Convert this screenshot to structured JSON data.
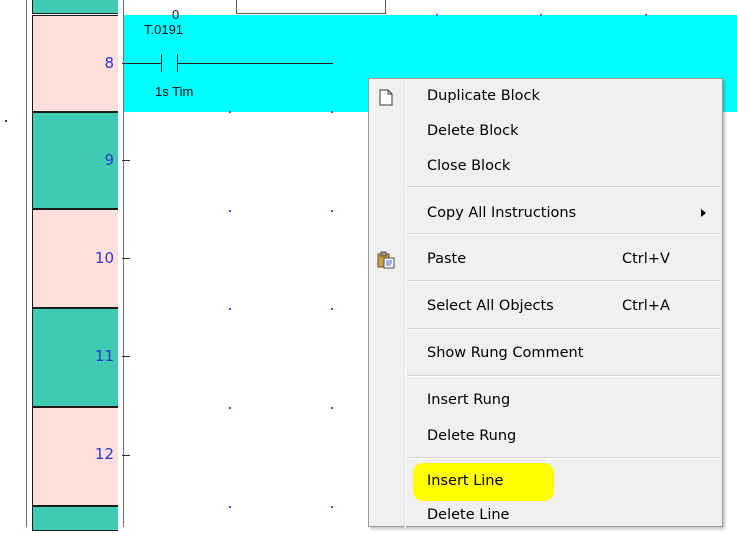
{
  "ladder": {
    "rungs": [
      {
        "number": "8",
        "fill": "#fde0dc"
      },
      {
        "number": "9",
        "fill": "#3fcbb1"
      },
      {
        "number": "10",
        "fill": "#fde0dc"
      },
      {
        "number": "11",
        "fill": "#3fcbb1"
      },
      {
        "number": "12",
        "fill": "#fde0dc"
      }
    ],
    "selected_rung_color": "#00ffff",
    "contact": {
      "value": "0",
      "address": "T.0191",
      "comment": "1s Tim"
    }
  },
  "context_menu": {
    "items": [
      {
        "id": "duplicate-block",
        "label": "Duplicate Block",
        "icon": "document-icon"
      },
      {
        "id": "delete-block",
        "label": "Delete Block"
      },
      {
        "id": "close-block",
        "label": "Close Block"
      },
      {
        "id": "copy-all-instructions",
        "label": "Copy All  Instructions",
        "submenu": true
      },
      {
        "id": "paste",
        "label": "Paste",
        "shortcut": "Ctrl+V",
        "icon": "clipboard-paste-icon"
      },
      {
        "id": "select-all-objects",
        "label": "Select All Objects",
        "shortcut": "Ctrl+A"
      },
      {
        "id": "show-rung-comment",
        "label": "Show Rung Comment"
      },
      {
        "id": "insert-rung",
        "label": "Insert Rung"
      },
      {
        "id": "delete-rung",
        "label": "Delete Rung"
      },
      {
        "id": "insert-line",
        "label": "Insert Line",
        "highlighted": true
      },
      {
        "id": "delete-line",
        "label": "Delete Line"
      }
    ],
    "highlight_color": "#ffff00"
  }
}
